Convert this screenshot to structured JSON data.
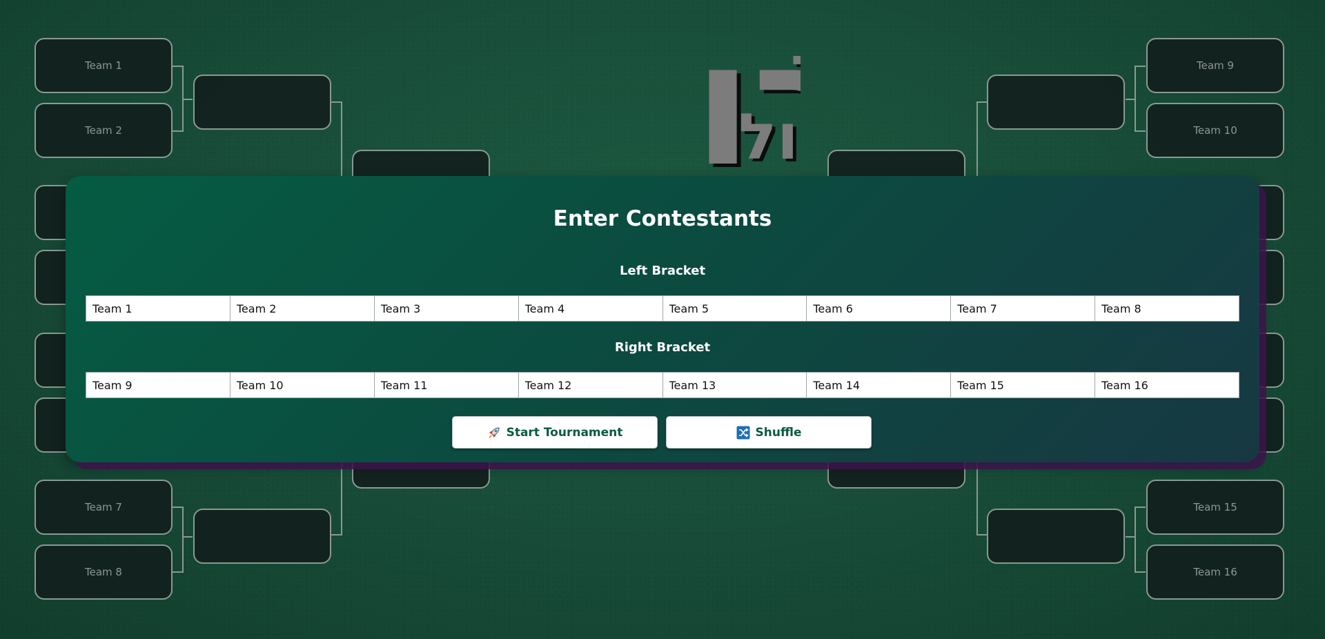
{
  "logo": {
    "text_top": "דפר",
    "text_bottom": "ול",
    "text_big": "רו"
  },
  "bracket": {
    "left_slots": [
      "Team 1",
      "Team 2",
      "",
      "",
      "",
      "",
      "Team 7",
      "Team 8"
    ],
    "right_slots": [
      "Team 9",
      "Team 10",
      "",
      "",
      "",
      "",
      "Team 15",
      "Team 16"
    ]
  },
  "panel": {
    "title": "Enter Contestants",
    "left_label": "Left Bracket",
    "right_label": "Right Bracket",
    "left_inputs": [
      "Team 1",
      "Team 2",
      "Team 3",
      "Team 4",
      "Team 5",
      "Team 6",
      "Team 7",
      "Team 8"
    ],
    "right_inputs": [
      "Team 9",
      "Team 10",
      "Team 11",
      "Team 12",
      "Team 13",
      "Team 14",
      "Team 15",
      "Team 16"
    ],
    "start_label": "Start Tournament",
    "shuffle_label": "Shuffle",
    "start_icon": "rocket-icon",
    "shuffle_icon": "shuffle-icon"
  },
  "colors": {
    "background": "#184d39",
    "panel_start": "#055c42",
    "panel_end": "#173842",
    "panel_shadow": "#3c144b",
    "button_text": "#0a5a40",
    "slot_border": "#8a9a92"
  }
}
